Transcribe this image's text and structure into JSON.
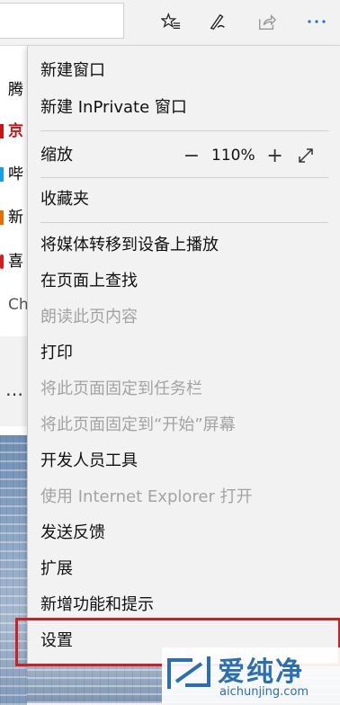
{
  "toolbar": {
    "icons": [
      "favorites-star-icon",
      "pen-notes-icon",
      "share-icon",
      "more-ellipsis-icon"
    ]
  },
  "page_behind": {
    "rows": [
      {
        "text": "腾",
        "mark_color": ""
      },
      {
        "text": "京",
        "mark_color": "#c81414"
      },
      {
        "text": "哔",
        "mark_color": "#1aa0e0"
      },
      {
        "text": "新",
        "mark_color": "#e07000"
      },
      {
        "text": "喜",
        "mark_color": "#d02020"
      },
      {
        "text": "Ch",
        "mark_color": ""
      }
    ],
    "dots": "…"
  },
  "menu": {
    "new_window": "新建窗口",
    "new_inprivate": "新建 InPrivate 窗口",
    "zoom_label": "缩放",
    "zoom_value": "110%",
    "zoom_minus": "−",
    "zoom_plus": "+",
    "favorites": "收藏夹",
    "cast_media": "将媒体转移到设备上播放",
    "find_on_page": "在页面上查找",
    "read_aloud": "朗读此页内容",
    "print": "打印",
    "pin_taskbar": "将此页面固定到任务栏",
    "pin_start": "将此页面固定到“开始”屏幕",
    "dev_tools": "开发人员工具",
    "open_ie": "使用 Internet Explorer 打开",
    "feedback": "发送反馈",
    "extensions": "扩展",
    "whats_new": "新增功能和提示",
    "settings": "设置"
  },
  "highlight_color": "#d01f1f",
  "watermark": {
    "name": "爱纯净",
    "url": "aichunjing.com"
  }
}
